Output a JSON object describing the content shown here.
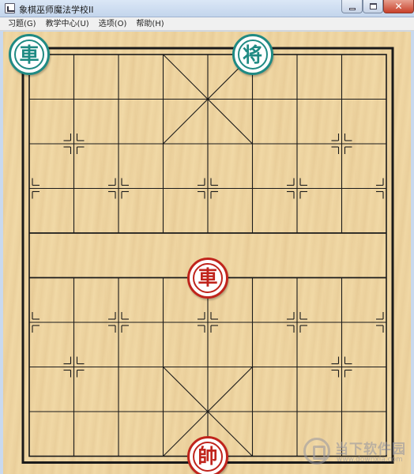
{
  "window": {
    "title": "象棋巫师魔法学校II",
    "close_glyph": "✕"
  },
  "menu": {
    "items": [
      "习题(G)",
      "教学中心(U)",
      "选项(O)",
      "帮助(H)"
    ]
  },
  "board": {
    "files": 9,
    "ranks": 10,
    "river_text": "",
    "line_color": "#1a1a1a",
    "wood_color": "#f1d9a6"
  },
  "pieces": [
    {
      "char": "車",
      "side": "green",
      "file": 0,
      "rank": 0,
      "color": "#1f8a83"
    },
    {
      "char": "将",
      "side": "green",
      "file": 5,
      "rank": 0,
      "color": "#1f8a83"
    },
    {
      "char": "車",
      "side": "red",
      "file": 4,
      "rank": 5,
      "color": "#c0241c"
    },
    {
      "char": "帥",
      "side": "red",
      "file": 4,
      "rank": 9,
      "color": "#c0241c"
    }
  ],
  "watermark": {
    "name": "当下软件园",
    "url": "www.downxia.com"
  }
}
